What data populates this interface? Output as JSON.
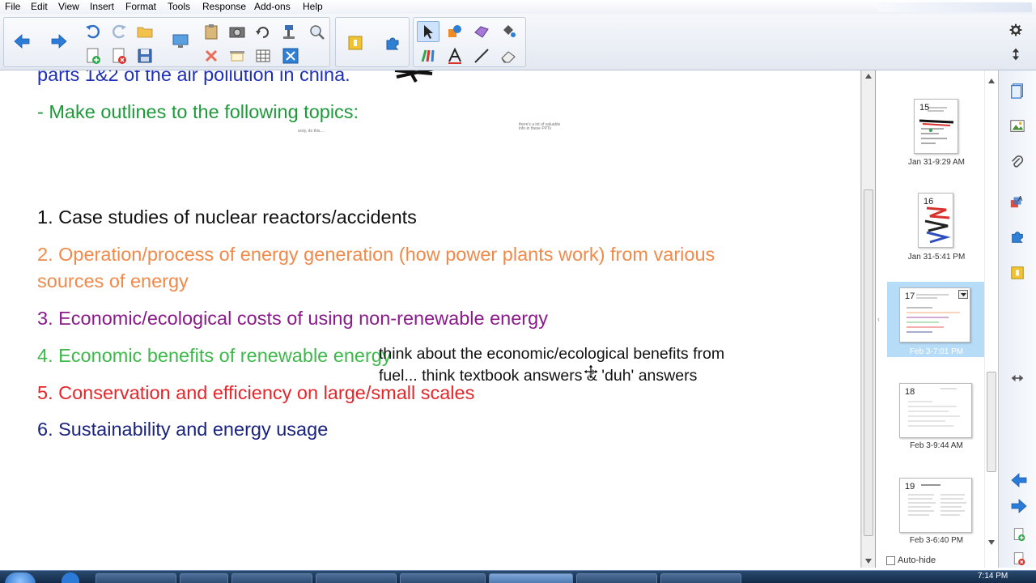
{
  "menu": [
    "File",
    "Edit",
    "View",
    "Insert",
    "Format",
    "Tools",
    "Response",
    "Add-ons",
    "Help"
  ],
  "slide": {
    "partial_line": "parts 1&2 of the air pollution in china.",
    "outline_heading": "- Make outlines to the following topics:",
    "tiny_note_1": "srsly, do this....",
    "tiny_note_2": "there's a lot of valuable",
    "tiny_note_3": "info in these PPTs",
    "topics": [
      {
        "text": "1. Case studies of nuclear reactors/accidents",
        "color": "#111111"
      },
      {
        "text": "2. Operation/process of energy generation (how power plants work) from various",
        "color": "#f08a4b"
      },
      {
        "text": "sources of energy",
        "color": "#f08a4b"
      },
      {
        "text": "3. Economic/ecological costs of using non-renewable energy",
        "color": "#8b1a8b"
      },
      {
        "text": "4. Economic benefits of renewable energy",
        "color": "#3db84a"
      },
      {
        "text": "5. Conservation and efficiency on large/small scales",
        "color": "#e6262a"
      },
      {
        "text": "6. Sustainability and energy usage",
        "color": "#1a237e"
      }
    ],
    "annotation_line_1": "think about the economic/ecological benefits from",
    "annotation_line_2": "fuel... think textbook answers & 'duh' answers"
  },
  "pages": [
    {
      "number": "15",
      "label": "Jan 31-9:29 AM"
    },
    {
      "number": "16",
      "label": "Jan 31-5:41 PM"
    },
    {
      "number": "17",
      "label": "Feb 3-7:01 PM",
      "selected": true
    },
    {
      "number": "18",
      "label": "Feb 3-9:44 AM"
    },
    {
      "number": "19",
      "label": "Feb 3-6:40 PM"
    }
  ],
  "autohide_label": "Auto-hide",
  "clock": "7:14 PM",
  "colors": {
    "accent": "#1e6fd9",
    "selection": "#b7dcf8"
  }
}
